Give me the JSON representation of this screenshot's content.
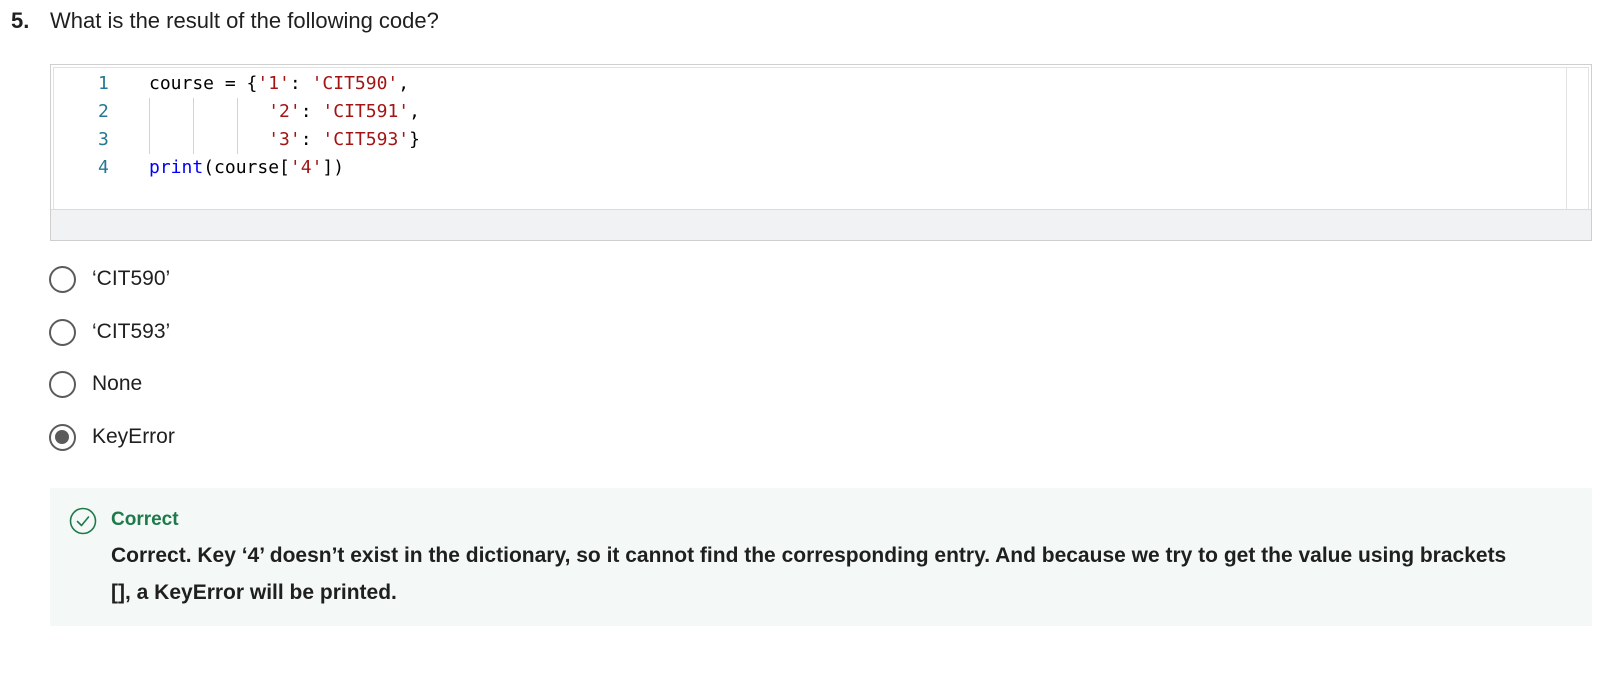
{
  "question": {
    "number": "5.",
    "text": "What is the result of the following code?"
  },
  "code": {
    "lines": [
      {
        "no": "1",
        "parts": [
          [
            "plain",
            "course = {"
          ],
          [
            "str",
            "'1'"
          ],
          [
            "plain",
            ": "
          ],
          [
            "str",
            "'CIT590'"
          ],
          [
            "plain",
            ","
          ]
        ]
      },
      {
        "no": "2",
        "parts": [
          [
            "plain",
            "           "
          ],
          [
            "str",
            "'2'"
          ],
          [
            "plain",
            ": "
          ],
          [
            "str",
            "'CIT591'"
          ],
          [
            "plain",
            ","
          ]
        ]
      },
      {
        "no": "3",
        "parts": [
          [
            "plain",
            "           "
          ],
          [
            "str",
            "'3'"
          ],
          [
            "plain",
            ": "
          ],
          [
            "str",
            "'CIT593'"
          ],
          [
            "plain",
            "}"
          ]
        ]
      },
      {
        "no": "4",
        "parts": [
          [
            "fn",
            "print"
          ],
          [
            "plain",
            "(course["
          ],
          [
            "str",
            "'4'"
          ],
          [
            "plain",
            "])"
          ]
        ]
      }
    ]
  },
  "options": [
    {
      "label": "‘CIT590’",
      "checked": false
    },
    {
      "label": "‘CIT593’",
      "checked": false
    },
    {
      "label": "None",
      "checked": false
    },
    {
      "label": "KeyError",
      "checked": true
    }
  ],
  "feedback": {
    "status": "Correct",
    "message": "Correct. Key ‘4’ doesn’t exist in the dictionary, so it cannot find the corresponding entry.  And because we try to get the value using brackets [], a KeyError will be printed.",
    "accent_color": "#1f7a4b"
  }
}
